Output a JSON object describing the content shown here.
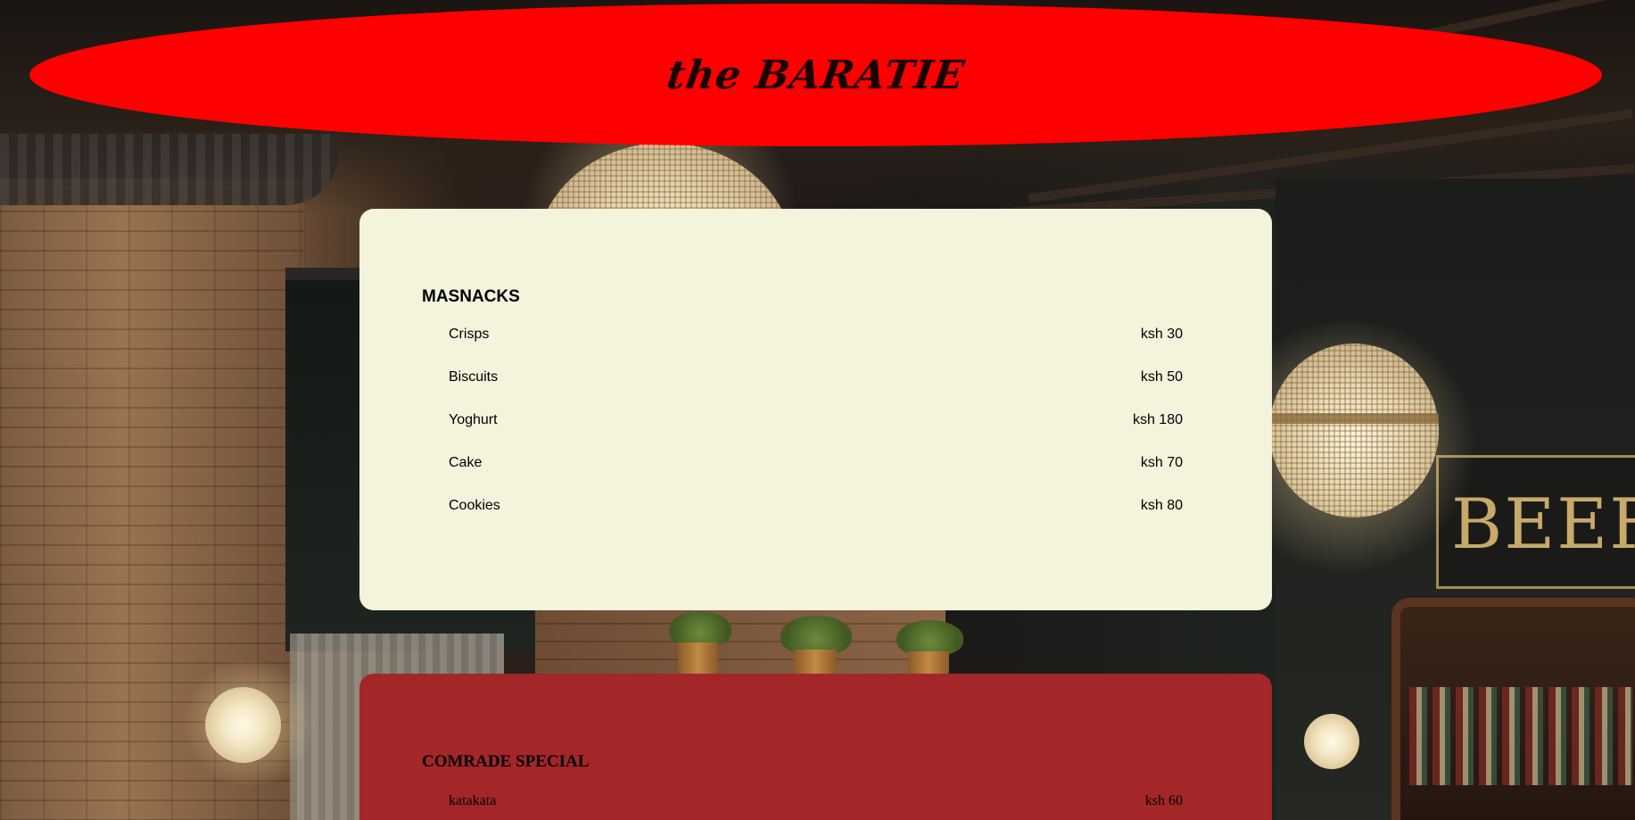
{
  "header": {
    "brand": "the BARATIE"
  },
  "background": {
    "sign_text": "BEEF"
  },
  "colors": {
    "header_bg": "#ff0000",
    "card_light_bg": "#f4f3dc",
    "card_dark_bg": "#a32628"
  },
  "sections": [
    {
      "title": "MASNACKS",
      "items": [
        {
          "name": "Crisps",
          "price": "ksh 30"
        },
        {
          "name": "Biscuits",
          "price": "ksh 50"
        },
        {
          "name": "Yoghurt",
          "price": "ksh 180"
        },
        {
          "name": "Cake",
          "price": "ksh 70"
        },
        {
          "name": "Cookies",
          "price": "ksh 80"
        }
      ]
    },
    {
      "title": "COMRADE SPECIAL",
      "items": [
        {
          "name": "katakata",
          "price": "ksh 60"
        }
      ]
    }
  ]
}
